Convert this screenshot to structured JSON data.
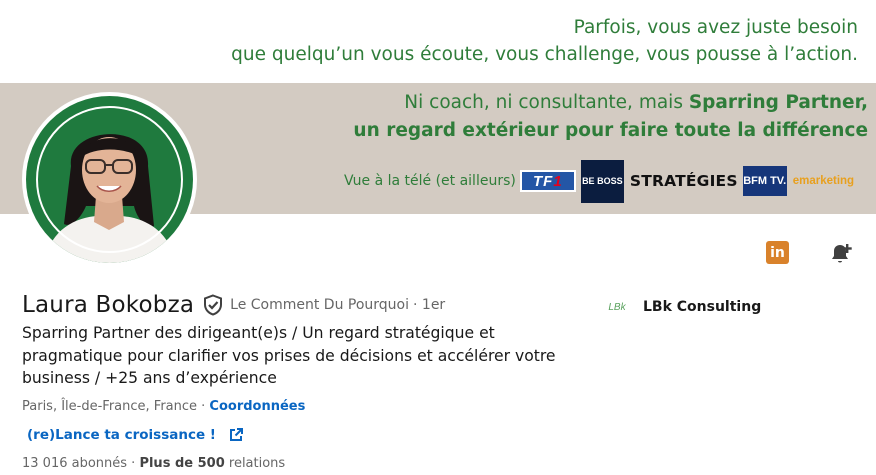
{
  "banner": {
    "tagline_line1": "Parfois, vous avez juste besoin",
    "tagline_line2": "que quelqu’un vous écoute, vous challenge, vous pousse à l’action.",
    "pitch_line1_prefix": "Ni coach, ni consultante, mais ",
    "pitch_line1_bold": "Sparring Partner,",
    "pitch_line2": "un regard extérieur pour faire toute la différence",
    "media_label": "Vue à la télé (et ailleurs)",
    "media_logos": {
      "tf1_a": "TF",
      "tf1_b": "1",
      "beboss": "BE BOSS",
      "strategies": "STRATÉGIES",
      "bfm": "BFM TV.",
      "emarketing": "emarketing"
    },
    "colors": {
      "text_green": "#2f7d3a",
      "band": "#d3cbc2"
    }
  },
  "profile": {
    "name": "Laura Bokobza",
    "pronoun": "Le Comment Du Pourquoi",
    "degree": "· 1er",
    "headline": "Sparring Partner des dirigeant(e)s / Un regard stratégique et pragmatique pour clarifier vos prises de décisions et accélérer votre business / +25 ans d’expérience",
    "location": "Paris, Île-de-France, France",
    "location_sep": " · ",
    "contact_label": "Coordonnées",
    "website_label": "(re)Lance ta croissance !",
    "followers": "13 016 abonnés",
    "stats_sep": " · ",
    "connections_bold": "Plus de 500",
    "connections_rest": " relations"
  },
  "company": {
    "logo_text": "LBk",
    "name": "LBk Consulting"
  },
  "actions": {
    "linkedin_icon_text": "in"
  },
  "colors": {
    "link": "#0a66c2",
    "secondary_text": "#666666",
    "avatar_bg": "#1f7a3e",
    "linkedin_orange": "#d9822b"
  }
}
